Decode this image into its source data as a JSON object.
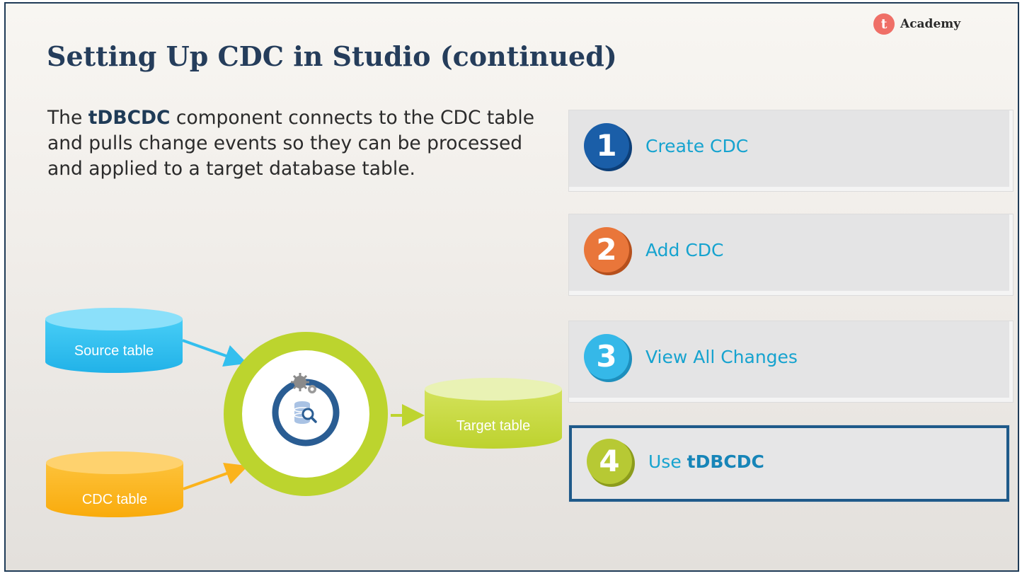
{
  "logo": {
    "letter": "t",
    "text": "Academy"
  },
  "title": "Setting Up CDC in Studio (continued)",
  "description": {
    "prefix": "The ",
    "component": "tDBCDC",
    "suffix": " component connects to the CDC table and pulls change events so they can be processed and applied to a target database table."
  },
  "diagram": {
    "source_label": "Source table",
    "cdc_label": "CDC table",
    "target_label": "Target table"
  },
  "steps": [
    {
      "number": "1",
      "label": "Create CDC",
      "color": "#1a5ea8"
    },
    {
      "number": "2",
      "label": "Add CDC",
      "color": "#e9763a"
    },
    {
      "number": "3",
      "label": "View All Changes",
      "color": "#35b8e8"
    },
    {
      "number": "4",
      "label_prefix": "Use ",
      "label_bold": "tDBCDC",
      "color": "#b7c934",
      "active": true
    }
  ],
  "colors": {
    "title": "#253d5b",
    "step_text": "#16a3cf",
    "active_border": "#1f5a8a",
    "source": "#2ac0f0",
    "cdc": "#fdb51e",
    "target": "#c9dc3c",
    "ring": "#bcd42e"
  }
}
